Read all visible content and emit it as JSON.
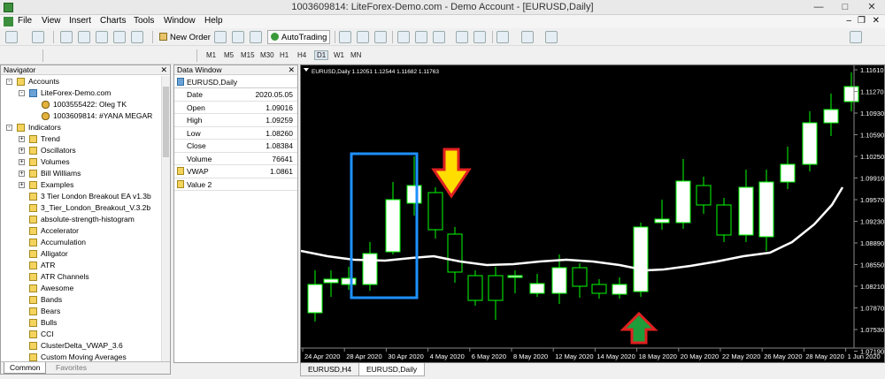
{
  "window": {
    "title": "1003609814: LiteForex-Demo.com - Demo Account - [EURUSD,Daily]"
  },
  "menu": [
    "File",
    "View",
    "Insert",
    "Charts",
    "Tools",
    "Window",
    "Help"
  ],
  "toolbar": {
    "new_order": "New Order",
    "autotrading": "AutoTrading"
  },
  "timeframes": [
    "M1",
    "M5",
    "M15",
    "M30",
    "H1",
    "H4",
    "D1",
    "W1",
    "MN"
  ],
  "active_timeframe": "D1",
  "navigator": {
    "title": "Navigator",
    "items": [
      {
        "label": "Accounts",
        "level": 0,
        "exp": "-",
        "icon": "folder"
      },
      {
        "label": "LiteForex-Demo.com",
        "level": 1,
        "exp": "-",
        "icon": "acc"
      },
      {
        "label": "1003555422: Oleg TK",
        "level": 2,
        "exp": "",
        "icon": "user"
      },
      {
        "label": "1003609814: #YANA MEGAR",
        "level": 2,
        "exp": "",
        "icon": "user"
      },
      {
        "label": "Indicators",
        "level": 0,
        "exp": "-",
        "icon": "folder"
      },
      {
        "label": "Trend",
        "level": 1,
        "exp": "+",
        "icon": "folder"
      },
      {
        "label": "Oscillators",
        "level": 1,
        "exp": "+",
        "icon": "folder"
      },
      {
        "label": "Volumes",
        "level": 1,
        "exp": "+",
        "icon": "folder"
      },
      {
        "label": "Bill Williams",
        "level": 1,
        "exp": "+",
        "icon": "folder"
      },
      {
        "label": "Examples",
        "level": 1,
        "exp": "+",
        "icon": "folder"
      },
      {
        "label": "3 Tier London Breakout EA v1.3b",
        "level": 1,
        "exp": "",
        "icon": "ind"
      },
      {
        "label": "3_Tier_London_Breakout_V.3.2b",
        "level": 1,
        "exp": "",
        "icon": "ind"
      },
      {
        "label": "absolute-strength-histogram",
        "level": 1,
        "exp": "",
        "icon": "ind"
      },
      {
        "label": "Accelerator",
        "level": 1,
        "exp": "",
        "icon": "ind"
      },
      {
        "label": "Accumulation",
        "level": 1,
        "exp": "",
        "icon": "ind"
      },
      {
        "label": "Alligator",
        "level": 1,
        "exp": "",
        "icon": "ind"
      },
      {
        "label": "ATR",
        "level": 1,
        "exp": "",
        "icon": "ind"
      },
      {
        "label": "ATR Channels",
        "level": 1,
        "exp": "",
        "icon": "ind"
      },
      {
        "label": "Awesome",
        "level": 1,
        "exp": "",
        "icon": "ind"
      },
      {
        "label": "Bands",
        "level": 1,
        "exp": "",
        "icon": "ind"
      },
      {
        "label": "Bears",
        "level": 1,
        "exp": "",
        "icon": "ind"
      },
      {
        "label": "Bulls",
        "level": 1,
        "exp": "",
        "icon": "ind"
      },
      {
        "label": "CCI",
        "level": 1,
        "exp": "",
        "icon": "ind"
      },
      {
        "label": "ClusterDelta_VWAP_3.6",
        "level": 1,
        "exp": "",
        "icon": "ind"
      },
      {
        "label": "Custom Moving Averages",
        "level": 1,
        "exp": "",
        "icon": "ind"
      }
    ],
    "tabs": [
      "Common",
      "Favorites"
    ]
  },
  "data_window": {
    "title": "Data Window",
    "symbol": "EURUSD,Daily",
    "rows": [
      {
        "k": "Date",
        "v": "2020.05.05"
      },
      {
        "k": "Open",
        "v": "1.09016"
      },
      {
        "k": "High",
        "v": "1.09259"
      },
      {
        "k": "Low",
        "v": "1.08260"
      },
      {
        "k": "Close",
        "v": "1.08384"
      },
      {
        "k": "Volume",
        "v": "76641"
      }
    ],
    "indicators": [
      {
        "k": "VWAP",
        "v": "1.0861"
      },
      {
        "k": "Value 2",
        "v": ""
      }
    ]
  },
  "chart": {
    "header": "EURUSD,Daily 1.12051 1.12544 1.11682 1.11763",
    "price_labels": [
      "1.11610",
      "1.11270",
      "1.10930",
      "1.10590",
      "1.10250",
      "1.09910",
      "1.09570",
      "1.09230",
      "1.08890",
      "1.08550",
      "1.08210",
      "1.07870",
      "1.07530",
      "1.07190"
    ],
    "date_labels": [
      "24 Apr 2020",
      "28 Apr 2020",
      "30 Apr 2020",
      "4 May 2020",
      "6 May 2020",
      "8 May 2020",
      "12 May 2020",
      "14 May 2020",
      "18 May 2020",
      "20 May 2020",
      "22 May 2020",
      "26 May 2020",
      "28 May 2020",
      "1 Jun 2020"
    ],
    "colors": {
      "bull": "#ffffff",
      "bear": "#000000",
      "wick": "#00ff00",
      "vwap": "#ffffff",
      "box": "#1e90ff",
      "down_arrow": "#ffdd00",
      "up_arrow": "#1f9d3a",
      "arrow_border": "#e02020"
    }
  },
  "bottom_tabs": [
    "EURUSD,H4",
    "EURUSD,Daily"
  ],
  "active_bottom_tab": "EURUSD,Daily"
}
